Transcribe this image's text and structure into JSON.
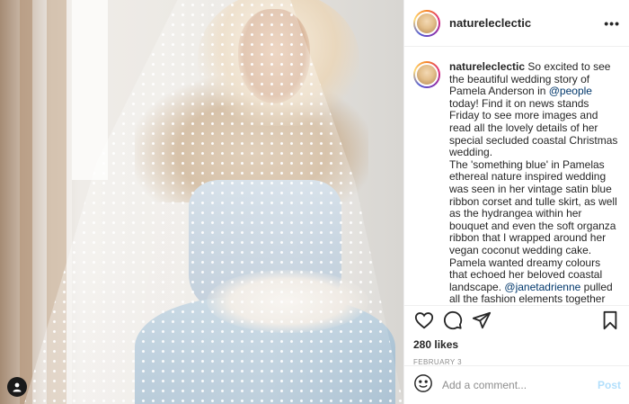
{
  "post": {
    "username": "natureleclectic",
    "photo_alt_subject": "bride in polka-dot veil",
    "caption": {
      "username": "natureleclectic",
      "text_1": " So excited to see the beautiful wedding story of Pamela Anderson in ",
      "mention_1": "@people",
      "text_2": " today! Find it on news stands Friday to see more images and read all the lovely details of her special secluded coastal Christmas wedding.",
      "text_3": "The 'something blue' in Pamelas ethereal nature inspired wedding was seen in her vintage satin blue ribbon corset and tulle skirt, as well as the hydrangea within her bouquet and even the soft organza ribbon that I wrapped around her vegan coconut wedding cake. Pamela wanted dreamy colours that echoed her beloved coastal landscape. ",
      "mention_2": "@janetadrienne",
      "text_4": " pulled all the fashion elements together beautifully for the radiant bride, who was blushing with love and excitement"
    },
    "likes": "280 likes",
    "date": "February 3"
  },
  "comment": {
    "placeholder": "Add a comment...",
    "post_label": "Post"
  },
  "icons": {
    "more": "more-options-icon",
    "like": "heart-icon",
    "comment": "comment-icon",
    "share": "share-icon",
    "save": "bookmark-icon",
    "emoji": "emoji-icon",
    "tag": "user-tag-icon"
  },
  "colors": {
    "link": "#00376b",
    "muted": "#8e8e8e",
    "post_button": "#b2dffc",
    "border": "#efefef"
  }
}
